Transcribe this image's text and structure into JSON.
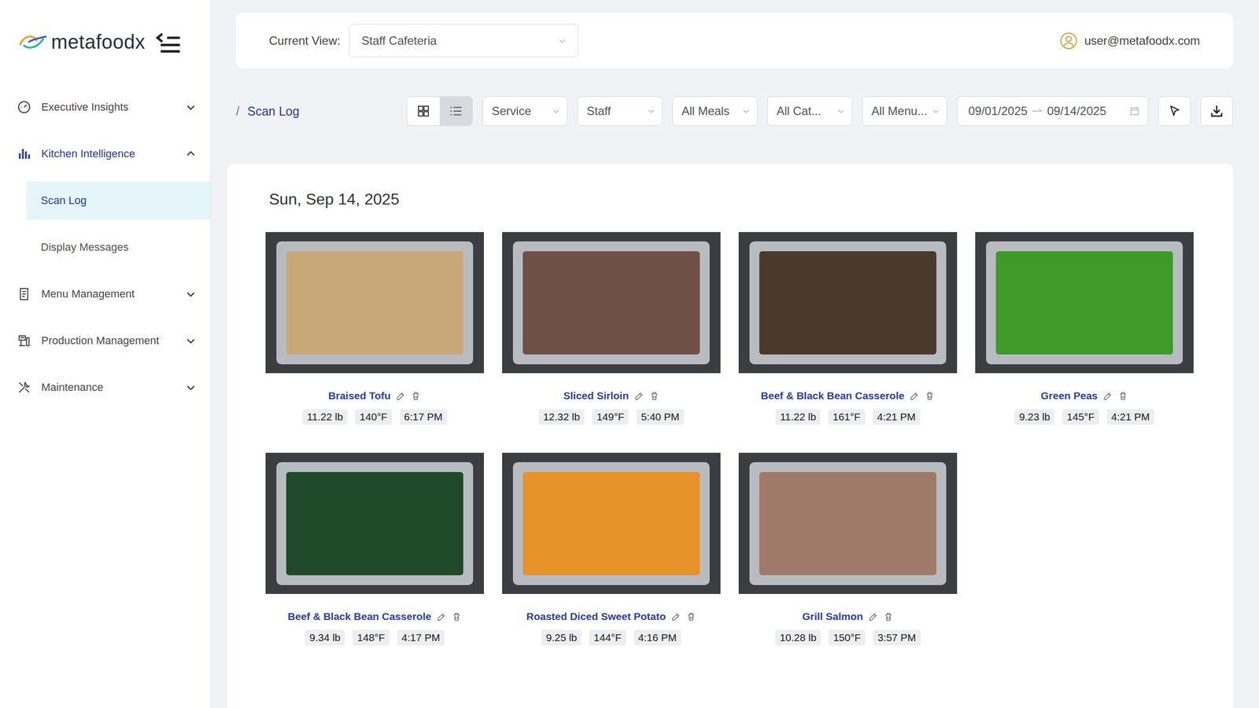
{
  "brand": {
    "name": "metafoodx"
  },
  "sidebar": {
    "items": [
      {
        "label": "Executive Insights",
        "selected": false,
        "expanded": false,
        "children": []
      },
      {
        "label": "Kitchen Intelligence",
        "selected": true,
        "expanded": true,
        "children": [
          {
            "label": "Scan Log",
            "selected": true
          },
          {
            "label": "Display Messages",
            "selected": false
          }
        ]
      },
      {
        "label": "Menu Management",
        "selected": false,
        "expanded": false,
        "children": []
      },
      {
        "label": "Production Management",
        "selected": false,
        "expanded": false,
        "children": []
      },
      {
        "label": "Maintenance",
        "selected": false,
        "expanded": false,
        "children": []
      }
    ]
  },
  "header": {
    "view_label": "Current View:",
    "view_value": "Staff Cafeteria",
    "user": "user@metafoodx.com"
  },
  "breadcrumb": {
    "separator": "/",
    "label": "Scan Log"
  },
  "toolbar": {
    "view_modes": [
      {
        "name": "grid",
        "selected": true
      },
      {
        "name": "list",
        "selected": false
      }
    ],
    "filters": [
      "Service",
      "Staff",
      "All Meals",
      "All Cat...",
      "All Menu..."
    ],
    "date_range": {
      "start": "09/01/2025",
      "end": "09/14/2025"
    }
  },
  "scan_log": {
    "date": "Sun, Sep 14, 2025",
    "scans": [
      {
        "name": "Braised Tofu",
        "weight": "11.22 lb",
        "temp": "140°F",
        "time": "6:17 PM",
        "color": "#c9a878"
      },
      {
        "name": "Sliced Sirloin",
        "weight": "12.32 lb",
        "temp": "149°F",
        "time": "5:40 PM",
        "color": "#6e5048"
      },
      {
        "name": "Beef & Black Bean Casserole",
        "weight": "11.22 lb",
        "temp": "161°F",
        "time": "4:21 PM",
        "color": "#4a3a2c"
      },
      {
        "name": "Green Peas",
        "weight": "9.23 lb",
        "temp": "145°F",
        "time": "4:21 PM",
        "color": "#3f9a2a"
      },
      {
        "name": "Beef & Black Bean Casserole",
        "weight": "9.34 lb",
        "temp": "148°F",
        "time": "4:17 PM",
        "color": "#1e4a2a"
      },
      {
        "name": "Roasted Diced Sweet Potato",
        "weight": "9.25 lb",
        "temp": "144°F",
        "time": "4:16 PM",
        "color": "#e8922a"
      },
      {
        "name": "Grill Salmon",
        "weight": "10.28 lb",
        "temp": "150°F",
        "time": "3:57 PM",
        "color": "#a07a68"
      }
    ]
  }
}
